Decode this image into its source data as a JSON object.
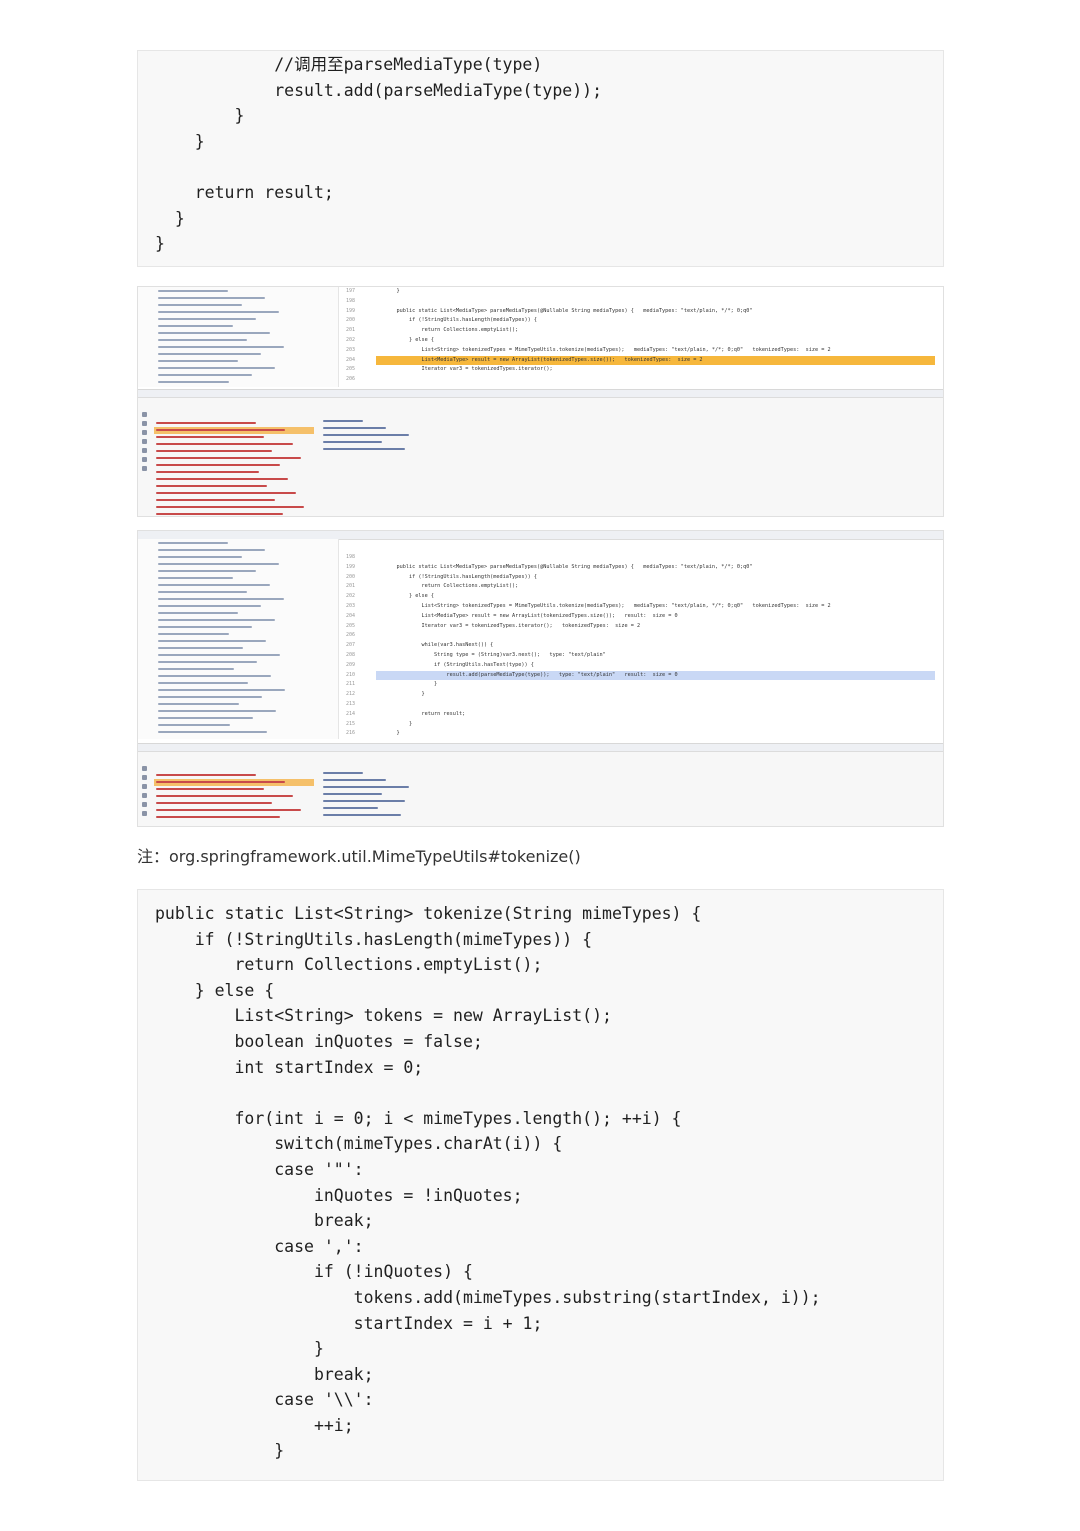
{
  "top_code": {
    "lines": [
      "            //调用至parseMediaType(type)",
      "            result.add(parseMediaType(type));",
      "        }",
      "    }",
      "",
      "    return result;",
      "  }",
      "}"
    ]
  },
  "ide1": {
    "gutter": [
      "197",
      "198",
      "199",
      "200",
      "201",
      "202",
      "203",
      "204",
      "205",
      "206"
    ],
    "editor_lines": [
      "    }",
      "",
      "    public static List<MediaType> parseMediaTypes(@Nullable String mediaTypes) {   mediaTypes: \"text/plain, */*; 0;q0\"",
      "        if (!StringUtils.hasLength(mediaTypes)) {",
      "            return Collections.emptyList();",
      "        } else {",
      "            List<String> tokenizedTypes = MimeTypeUtils.tokenize(mediaTypes);   mediaTypes: \"text/plain, */*; 0;q0\"   tokenizedTypes:  size = 2",
      "            List<MediaType> result = new ArrayList(tokenizedTypes.size());   tokenizedTypes:  size = 2",
      "            Iterator var3 = tokenizedTypes.iterator();",
      ""
    ]
  },
  "ide2": {
    "gutter": [
      "198",
      "199",
      "200",
      "201",
      "202",
      "203",
      "204",
      "205",
      "206",
      "207",
      "208",
      "209",
      "210",
      "211",
      "212",
      "213",
      "214",
      "215",
      "216"
    ],
    "editor_lines": [
      "",
      "    public static List<MediaType> parseMediaTypes(@Nullable String mediaTypes) {   mediaTypes: \"text/plain, */*; 0;q0\"",
      "        if (!StringUtils.hasLength(mediaTypes)) {",
      "            return Collections.emptyList();",
      "        } else {",
      "            List<String> tokenizedTypes = MimeTypeUtils.tokenize(mediaTypes);   mediaTypes: \"text/plain, */*; 0;q0\"   tokenizedTypes:  size = 2",
      "            List<MediaType> result = new ArrayList(tokenizedTypes.size());   result:  size = 0",
      "            Iterator var3 = tokenizedTypes.iterator();   tokenizedTypes:  size = 2",
      "",
      "            while(var3.hasNext()) {",
      "                String type = (String)var3.next();   type: \"text/plain\"",
      "                if (StringUtils.hasText(type)) {",
      "                    result.add(parseMediaType(type));   type: \"text/plain\"   result:  size = 0",
      "                }",
      "            }",
      "",
      "            return result;",
      "        }",
      "    }"
    ]
  },
  "note": {
    "label": "注：org.springframework.util.MimeTypeUtils#tokenize()"
  },
  "bottom_code": {
    "lines": [
      "public static List<String> tokenize(String mimeTypes) {",
      "    if (!StringUtils.hasLength(mimeTypes)) {",
      "        return Collections.emptyList();",
      "    } else {",
      "        List<String> tokens = new ArrayList();",
      "        boolean inQuotes = false;",
      "        int startIndex = 0;",
      "",
      "        for(int i = 0; i < mimeTypes.length(); ++i) {",
      "            switch(mimeTypes.charAt(i)) {",
      "            case '\"':",
      "                inQuotes = !inQuotes;",
      "                break;",
      "            case ',':",
      "                if (!inQuotes) {",
      "                    tokens.add(mimeTypes.substring(startIndex, i));",
      "                    startIndex = i + 1;",
      "                }",
      "                break;",
      "            case '\\\\':",
      "                ++i;",
      "            }"
    ]
  }
}
